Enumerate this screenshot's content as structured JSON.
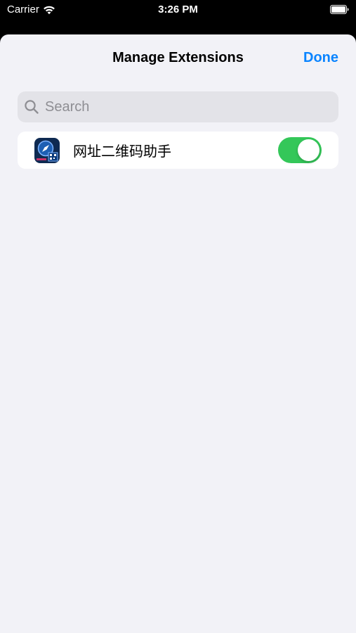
{
  "status_bar": {
    "carrier": "Carrier",
    "time": "3:26 PM",
    "wifi_icon": "wifi-icon",
    "battery_icon": "battery-icon"
  },
  "nav": {
    "title": "Manage Extensions",
    "done_label": "Done"
  },
  "search": {
    "placeholder": "Search",
    "value": ""
  },
  "extensions": [
    {
      "name": "网址二维码助手",
      "icon": "compass-qr-app-icon",
      "enabled": true
    }
  ],
  "colors": {
    "accent": "#0a84ff",
    "toggle_on": "#34c759",
    "sheet_background": "#f2f2f7",
    "search_background": "#e3e3e8"
  }
}
